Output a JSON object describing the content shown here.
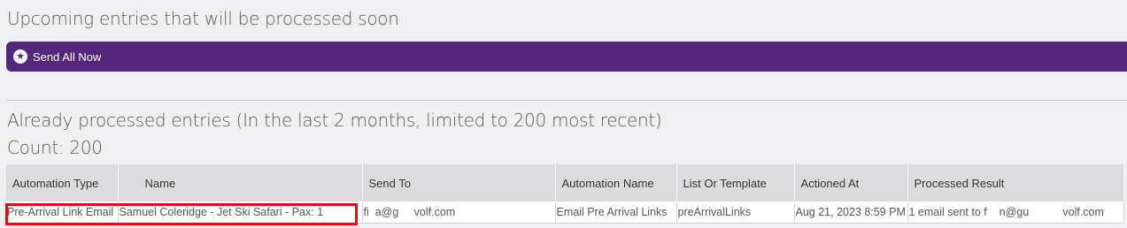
{
  "upcoming": {
    "title": "Upcoming entries that will be processed soon",
    "send_all_label": "Send All Now"
  },
  "processed": {
    "title": "Already processed entries (In the last 2 months, limited to 200 most recent)",
    "count_label": "Count: 200"
  },
  "table": {
    "columns": [
      "Automation Type",
      "Name",
      "Send To",
      "Automation Name",
      "List Or Template",
      "Actioned At",
      "Processed Result"
    ],
    "rows": [
      {
        "automation_type": "Pre-Arrival Link Email",
        "name": "Samuel Coleridge - Jet Ski Safari - Pax: 1",
        "send_to": "fi  a@g     volf.com",
        "automation_name": "Email Pre Arrival Links",
        "list_or_template": "preArrivalLinks",
        "actioned_at": "Aug 21, 2023 8:59 PM",
        "processed_result": "1 email sent to f    n@gu           volf.com"
      }
    ]
  },
  "colors": {
    "accent": "#54267c",
    "highlight": "#e01010",
    "header_bg": "#dcdcde",
    "page_bg": "#f0f0f2"
  },
  "icons": {
    "send_all": "star-circle-icon"
  }
}
